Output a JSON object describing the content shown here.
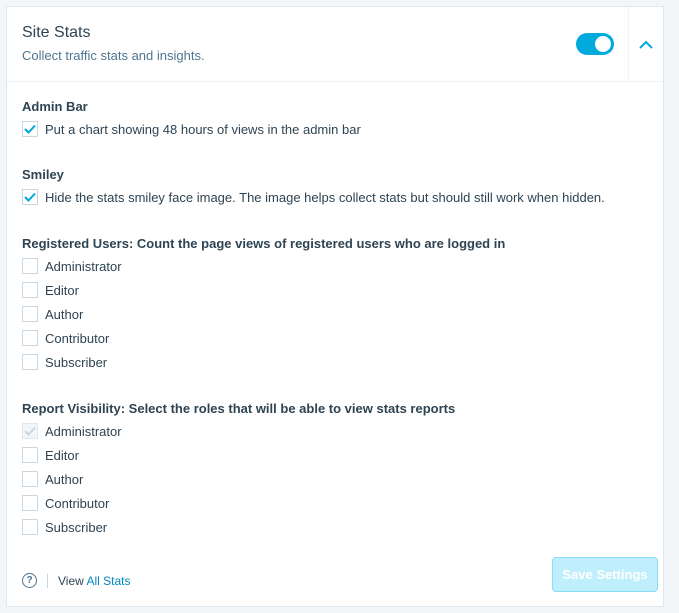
{
  "header": {
    "title": "Site Stats",
    "subtitle": "Collect traffic stats and insights.",
    "toggle_on": true
  },
  "admin_bar": {
    "heading": "Admin Bar",
    "option": "Put a chart showing 48 hours of views in the admin bar",
    "checked": true
  },
  "smiley": {
    "heading": "Smiley",
    "option": "Hide the stats smiley face image. The image helps collect stats but should still work when hidden.",
    "checked": true
  },
  "registered": {
    "heading": "Registered Users: Count the page views of registered users who are logged in",
    "roles": [
      "Administrator",
      "Editor",
      "Author",
      "Contributor",
      "Subscriber"
    ]
  },
  "report": {
    "heading": "Report Visibility: Select the roles that will be able to view stats reports",
    "roles": [
      "Administrator",
      "Editor",
      "Author",
      "Contributor",
      "Subscriber"
    ]
  },
  "footer": {
    "link_view": "View",
    "link_rest": "All Stats",
    "save": "Save Settings"
  },
  "colors": {
    "accent": "#00aadc"
  }
}
